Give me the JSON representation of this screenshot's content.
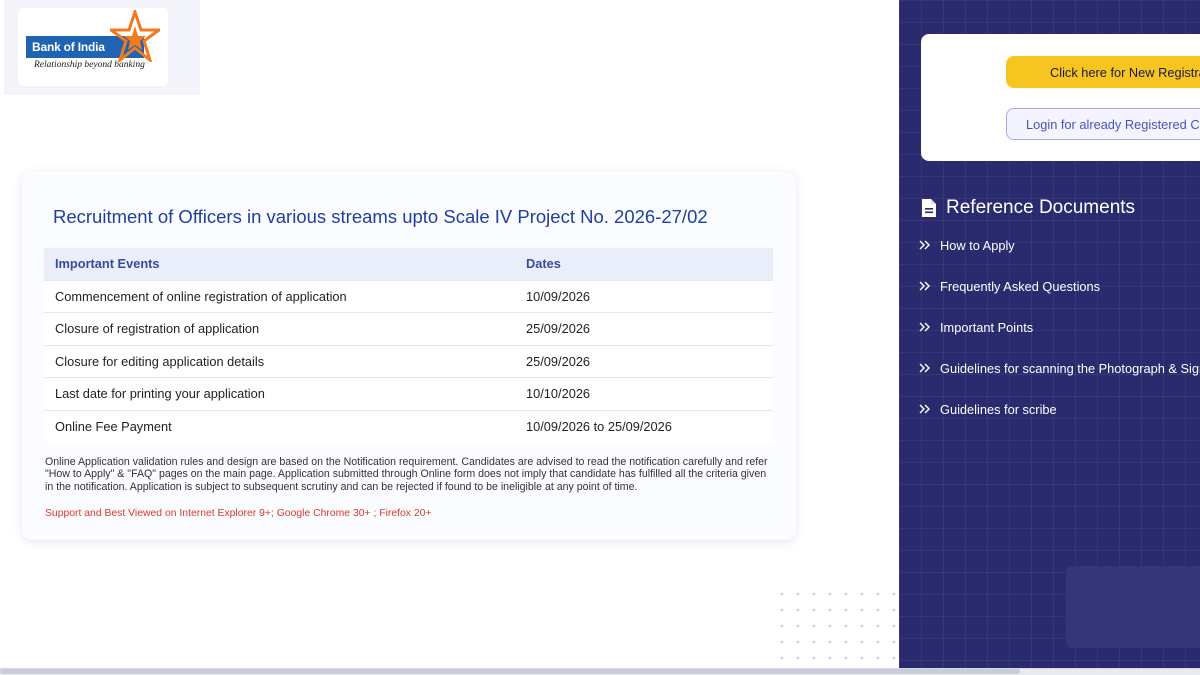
{
  "brand": {
    "name": "Bank of India",
    "tagline": "Relationship beyond banking",
    "colors": {
      "band": "#1f63b3",
      "star": "#f07a1d"
    }
  },
  "main": {
    "title": "Recruitment of Officers in various streams upto Scale IV Project No. 2026-27/02",
    "table": {
      "headers": [
        "Important Events",
        "Dates"
      ],
      "rows": [
        {
          "event": "Commencement of online registration of application",
          "date": "10/09/2026"
        },
        {
          "event": "Closure of registration of application",
          "date": "25/09/2026"
        },
        {
          "event": "Closure for editing application details",
          "date": "25/09/2026"
        },
        {
          "event": "Last date for printing your application",
          "date": "10/10/2026"
        },
        {
          "event": "Online Fee Payment",
          "date": "10/09/2026 to 25/09/2026"
        }
      ]
    },
    "notice": "Online Application validation rules and design are based on the Notification requirement. Candidates are advised to read the notification carefully and refer \"How to Apply\" & \"FAQ\" pages on the main page. Application submitted through Online form does not imply that candidate has fulfilled all the criteria given in the notification. Application is subject to subsequent scrutiny and can be rejected if found to be ineligible at any point of time.",
    "support": "Support and Best Viewed on Internet Explorer 9+; Google Chrome 30+ ; Firefox 20+"
  },
  "sidebar": {
    "new_registration_label": "Click here for New Registration",
    "login_label": "Login for already Registered Candidates",
    "reference_title": "Reference Documents",
    "reference_icon": "document-icon",
    "items": [
      {
        "label": "How to Apply"
      },
      {
        "label": "Frequently Asked Questions"
      },
      {
        "label": "Important Points"
      },
      {
        "label": "Guidelines for scanning the Photograph & Signature"
      },
      {
        "label": "Guidelines for scribe"
      }
    ],
    "colors": {
      "panel": "#2a2b6e",
      "primary_button": "#f7c520",
      "secondary_button_text": "#4a54b8"
    }
  }
}
